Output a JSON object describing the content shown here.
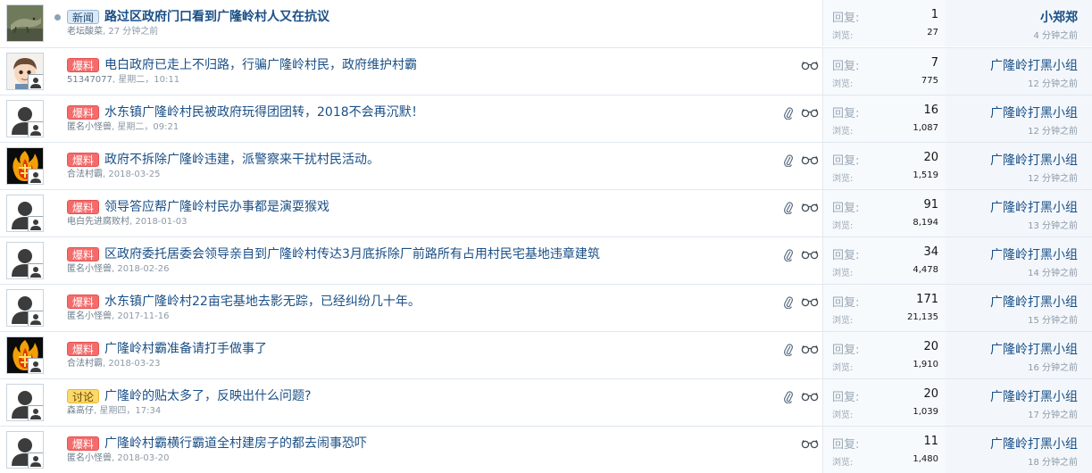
{
  "labels": {
    "replies": "回复:",
    "views": "浏览:"
  },
  "colors": {
    "title_link": "#1a4f86",
    "prefix_red": "#f46b6b",
    "prefix_blue": "#dbe9f7",
    "prefix_yellow": "#fbd96a",
    "stats_bg": "#f7fafd"
  },
  "threads": [
    {
      "avatar": "lizard-photo",
      "unread": true,
      "prefix": "新闻",
      "prefix_style": "blue",
      "title": "路过区政府门口看到广隆岭村人又在抗议",
      "title_bold": true,
      "author": "老坛酸菜",
      "date": "27 分钟之前",
      "attachment": false,
      "watched": false,
      "replies": "1",
      "views": "27",
      "last_poster": "小郑郑",
      "last_bold": true,
      "last_time": "4 分钟之前"
    },
    {
      "avatar": "cartoon-boy",
      "unread": false,
      "prefix": "爆料",
      "prefix_style": "red",
      "title": "电白政府已走上不归路，行骗广隆岭村民，政府维护村霸",
      "title_bold": false,
      "author": "51347077",
      "date": "星期二，10:11",
      "attachment": false,
      "watched": true,
      "replies": "7",
      "views": "775",
      "last_poster": "广隆岭打黑小组",
      "last_bold": false,
      "last_time": "12 分钟之前"
    },
    {
      "avatar": "default-person",
      "unread": false,
      "prefix": "爆料",
      "prefix_style": "red",
      "title": "水东镇广隆岭村民被政府玩得团团转，2018不会再沉默！",
      "title_bold": false,
      "author": "匿名小怪兽",
      "date": "星期二，09:21",
      "attachment": true,
      "watched": true,
      "replies": "16",
      "views": "1,087",
      "last_poster": "广隆岭打黑小组",
      "last_bold": false,
      "last_time": "12 分钟之前"
    },
    {
      "avatar": "fire-character",
      "unread": false,
      "prefix": "爆料",
      "prefix_style": "red",
      "title": "政府不拆除广隆岭违建，派警察来干扰村民活动。",
      "title_bold": false,
      "author": "合法村霸",
      "date": "2018-03-25",
      "attachment": true,
      "watched": true,
      "replies": "20",
      "views": "1,519",
      "last_poster": "广隆岭打黑小组",
      "last_bold": false,
      "last_time": "12 分钟之前"
    },
    {
      "avatar": "default-person",
      "unread": false,
      "prefix": "爆料",
      "prefix_style": "red",
      "title": "领导答应帮广隆岭村民办事都是演耍猴戏",
      "title_bold": false,
      "author": "电白先进腐败村",
      "date": "2018-01-03",
      "attachment": true,
      "watched": true,
      "replies": "91",
      "views": "8,194",
      "last_poster": "广隆岭打黑小组",
      "last_bold": false,
      "last_time": "13 分钟之前"
    },
    {
      "avatar": "default-person",
      "unread": false,
      "prefix": "爆料",
      "prefix_style": "red",
      "title": "区政府委托居委会领导亲自到广隆岭村传达3月底拆除厂前路所有占用村民宅基地违章建筑",
      "title_bold": false,
      "author": "匿名小怪兽",
      "date": "2018-02-26",
      "attachment": true,
      "watched": true,
      "replies": "34",
      "views": "4,478",
      "last_poster": "广隆岭打黑小组",
      "last_bold": false,
      "last_time": "14 分钟之前"
    },
    {
      "avatar": "default-person",
      "unread": false,
      "prefix": "爆料",
      "prefix_style": "red",
      "title": "水东镇广隆岭村22亩宅基地去影无踪，已经纠纷几十年。",
      "title_bold": false,
      "author": "匿名小怪兽",
      "date": "2017-11-16",
      "attachment": true,
      "watched": true,
      "replies": "171",
      "views": "21,135",
      "last_poster": "广隆岭打黑小组",
      "last_bold": false,
      "last_time": "15 分钟之前"
    },
    {
      "avatar": "fire-character",
      "unread": false,
      "prefix": "爆料",
      "prefix_style": "red",
      "title": "广隆岭村霸准备请打手做事了",
      "title_bold": false,
      "author": "合法村霸",
      "date": "2018-03-23",
      "attachment": true,
      "watched": true,
      "replies": "20",
      "views": "1,910",
      "last_poster": "广隆岭打黑小组",
      "last_bold": false,
      "last_time": "16 分钟之前"
    },
    {
      "avatar": "default-person",
      "unread": false,
      "prefix": "讨论",
      "prefix_style": "yellow",
      "title": "广隆岭的贴太多了，反映出什么问题?",
      "title_bold": false,
      "author": "森高仔",
      "date": "星期四，17:34",
      "attachment": true,
      "watched": true,
      "replies": "20",
      "views": "1,039",
      "last_poster": "广隆岭打黑小组",
      "last_bold": false,
      "last_time": "17 分钟之前"
    },
    {
      "avatar": "default-person",
      "unread": false,
      "prefix": "爆料",
      "prefix_style": "red",
      "title": "广隆岭村霸横行霸道全村建房子的都去闹事恐吓",
      "title_bold": false,
      "author": "匿名小怪兽",
      "date": "2018-03-20",
      "attachment": false,
      "watched": true,
      "replies": "11",
      "views": "1,480",
      "last_poster": "广隆岭打黑小组",
      "last_bold": false,
      "last_time": "18 分钟之前"
    }
  ]
}
